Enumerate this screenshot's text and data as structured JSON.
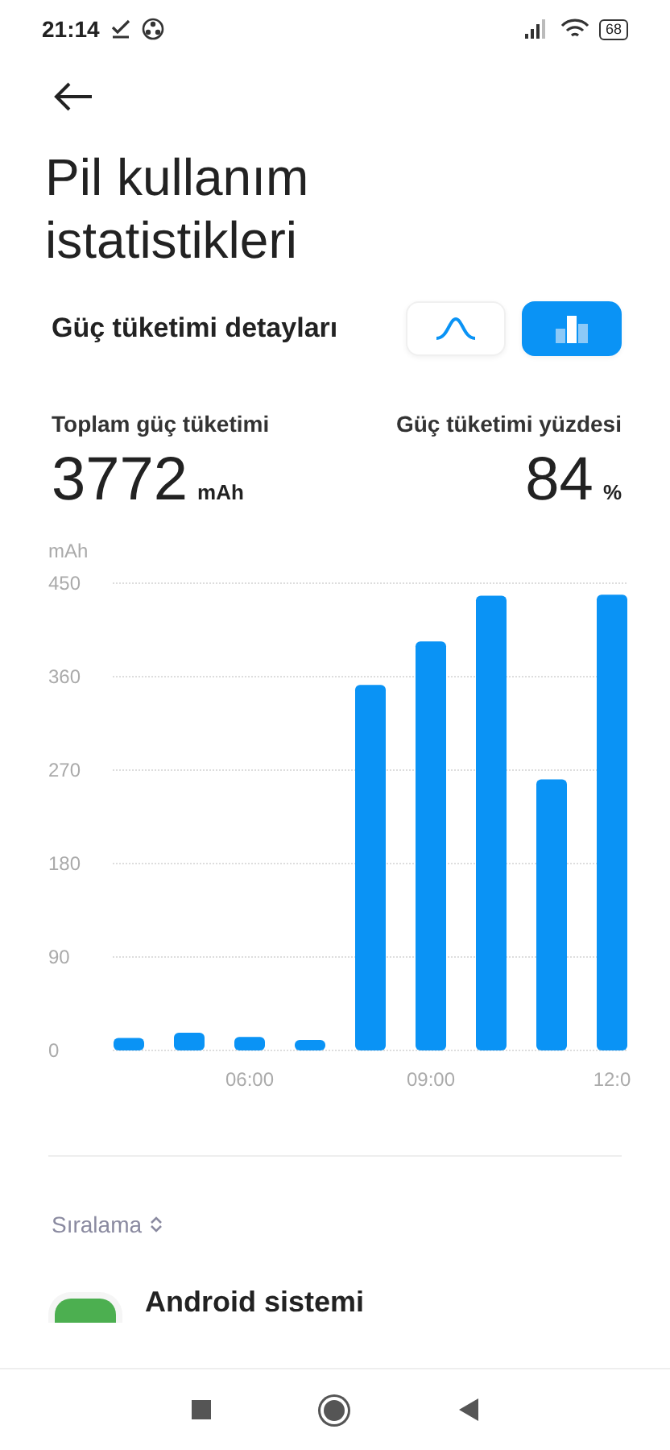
{
  "status_bar": {
    "time": "21:14",
    "battery": "68"
  },
  "title": "Pil kullanım istatistikleri",
  "section": {
    "title": "Güç tüketimi detayları",
    "toggles": [
      {
        "kind": "curve",
        "selected": false
      },
      {
        "kind": "bar",
        "selected": true
      }
    ]
  },
  "stats": [
    {
      "label": "Toplam güç tüketimi",
      "value": "3772",
      "unit": "mAh"
    },
    {
      "label": "Güç tüketimi yüzdesi",
      "value": "84",
      "unit": "%"
    }
  ],
  "chart_data": {
    "type": "bar",
    "ylabel": "mAh",
    "categories": [
      null,
      null,
      "06:00",
      null,
      null,
      "09:00",
      null,
      null,
      "12:0"
    ],
    "series": [
      {
        "color": "#0a93f5",
        "values": [
          12,
          17,
          13,
          10,
          352,
          394,
          438,
          261,
          439
        ]
      }
    ],
    "ylim": [
      0,
      450
    ],
    "yticks": [
      0,
      90,
      180,
      270,
      360,
      450
    ],
    "grid": true
  },
  "sort": {
    "label": "Sıralama"
  },
  "apps": [
    {
      "name": "Android sistemi"
    }
  ]
}
